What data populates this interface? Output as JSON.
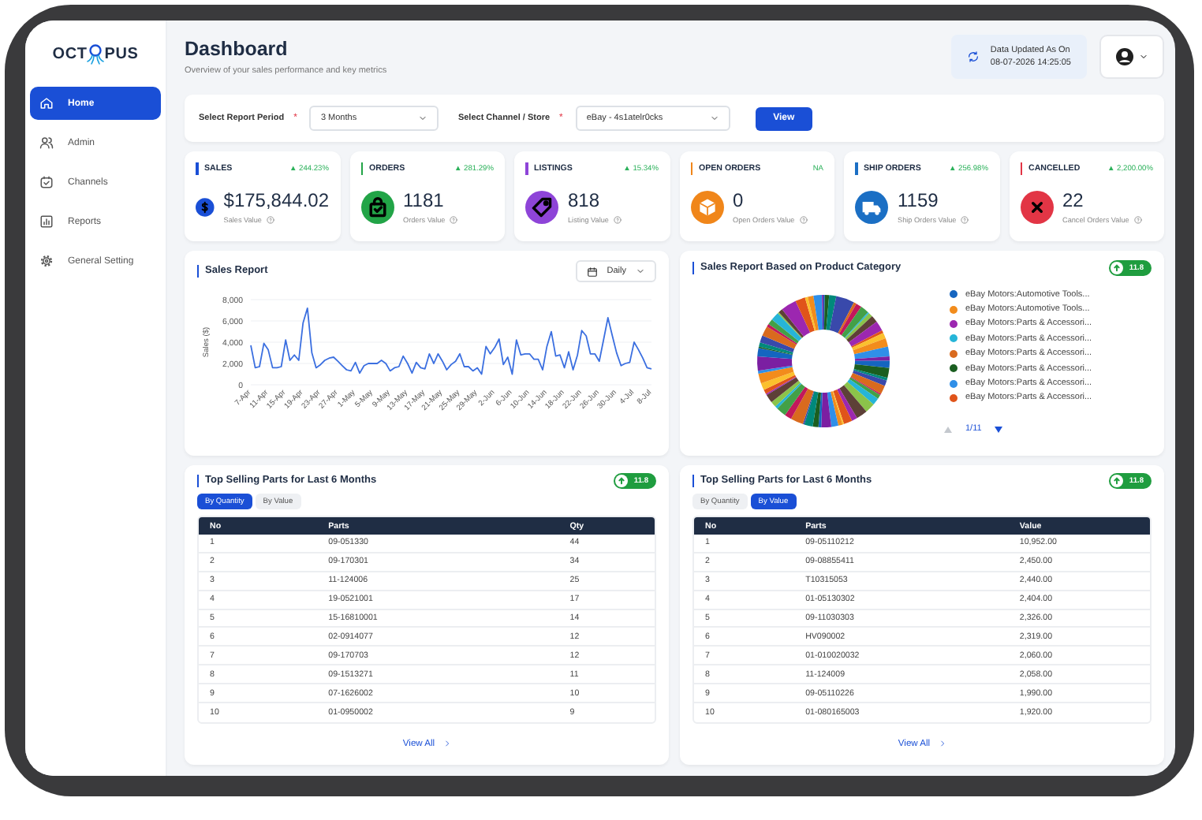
{
  "sidebar": {
    "logo": [
      "OCT",
      "PUS"
    ],
    "items": [
      {
        "label": "Home",
        "selected": true
      },
      {
        "label": "Admin",
        "selected": false
      },
      {
        "label": "Channels",
        "selected": false
      },
      {
        "label": "Reports",
        "selected": false
      },
      {
        "label": "General Setting",
        "selected": false
      }
    ]
  },
  "header": {
    "title": "Dashboard",
    "subtitle": "Overview of your sales performance and key metrics",
    "updated_label": "Data Updated As On",
    "updated_at": "08-07-2026 14:25:05"
  },
  "filters": {
    "fields": [
      {
        "label": "Select Report Period",
        "required_mark": "*",
        "value": "3 Months"
      },
      {
        "label": "Select Channel / Store",
        "required_mark": "*",
        "value": "eBay - 4s1atelr0cks"
      }
    ],
    "button": "View"
  },
  "kpis": [
    {
      "label": "SALES",
      "change": "▲ 244.23%",
      "value": "$175,844.02",
      "caption": "Sales Value",
      "color": "#1a4fd6"
    },
    {
      "label": "ORDERS",
      "change": "▲ 281.29%",
      "value": "1181",
      "caption": "Orders Value",
      "color": "#22a447"
    },
    {
      "label": "LISTINGS",
      "change": "▲ 15.34%",
      "value": "818",
      "caption": "Listing Value",
      "color": "#8e44d8"
    },
    {
      "label": "OPEN ORDERS",
      "change": "NA",
      "value": "0",
      "caption": "Open Orders Value",
      "color": "#f0861a"
    },
    {
      "label": "SHIP ORDERS",
      "change": "▲ 256.98%",
      "value": "1159",
      "caption": "Ship Orders Value",
      "color": "#1b6fc4"
    },
    {
      "label": "CANCELLED",
      "change": "▲ 2,200.00%",
      "value": "22",
      "caption": "Cancel Orders Value",
      "color": "#e23545"
    }
  ],
  "sales_report": {
    "control": "Daily",
    "chart_data": {
      "type": "line",
      "title": "Sales Report",
      "ylabel": "Sales ($)",
      "ylim": [
        0,
        8000
      ],
      "grid": true,
      "categories": [
        "7-Apr",
        null,
        null,
        null,
        "11-Apr",
        null,
        null,
        null,
        "15-Apr",
        null,
        null,
        null,
        "19-Apr",
        null,
        null,
        null,
        "23-Apr",
        null,
        null,
        null,
        "27-Apr",
        null,
        null,
        null,
        "1-May",
        null,
        null,
        null,
        "5-May",
        null,
        null,
        null,
        "9-May",
        null,
        null,
        null,
        "13-May",
        null,
        null,
        null,
        "17-May",
        null,
        null,
        null,
        "21-May",
        null,
        null,
        null,
        "25-May",
        null,
        null,
        null,
        "29-May",
        null,
        null,
        null,
        "2-Jun",
        null,
        null,
        null,
        "6-Jun",
        null,
        null,
        null,
        "10-Jun",
        null,
        null,
        null,
        "14-Jun",
        null,
        null,
        null,
        "18-Jun",
        null,
        null,
        null,
        "22-Jun",
        null,
        null,
        null,
        "26-Jun",
        null,
        null,
        null,
        "30-Jun",
        null,
        null,
        null,
        "4-Jul",
        null,
        null,
        null,
        "8-Jul"
      ],
      "yticks": [
        {
          "value": 0,
          "label": "0"
        },
        {
          "value": 2000,
          "label": "2,000"
        },
        {
          "value": 4000,
          "label": "4,000"
        },
        {
          "value": 6000,
          "label": "6,000"
        },
        {
          "value": 8000,
          "label": "8,000"
        }
      ],
      "series": [
        {
          "color": "#3b6fe0",
          "values": [
            3700,
            1600,
            1700,
            3900,
            3300,
            1600,
            1600,
            1700,
            4200,
            2300,
            2800,
            2300,
            5800,
            7200,
            3000,
            1600,
            1900,
            2300,
            2500,
            2600,
            2200,
            1800,
            1400,
            1300,
            2100,
            1100,
            1800,
            2000,
            2000,
            2000,
            2300,
            2000,
            1300,
            1600,
            1700,
            2700,
            2000,
            1100,
            2100,
            1600,
            1500,
            2900,
            2000,
            2900,
            2200,
            1400,
            1900,
            2200,
            2900,
            1700,
            1700,
            1300,
            1600,
            1000,
            3600,
            2900,
            3500,
            4300,
            1900,
            2600,
            1000,
            4200,
            2800,
            2900,
            2900,
            2400,
            2400,
            1400,
            3600,
            5000,
            2700,
            2800,
            1600,
            3100,
            1400,
            2800,
            5100,
            4600,
            2900,
            2900,
            2200,
            4200,
            6300,
            4600,
            3000,
            1800,
            2000,
            2100,
            4000,
            3300,
            2500,
            1600,
            1500
          ]
        }
      ]
    }
  },
  "category_report": {
    "title": "Sales Report Based on Product Category",
    "badge": "11.8",
    "legend": [
      {
        "label": "eBay Motors:Automotive Tools...",
        "color": "#1565c0"
      },
      {
        "label": "eBay Motors:Automotive Tools...",
        "color": "#f28c1c"
      },
      {
        "label": "eBay Motors:Parts & Accessori...",
        "color": "#9c27b0"
      },
      {
        "label": "eBay Motors:Parts & Accessori...",
        "color": "#26b5d8"
      },
      {
        "label": "eBay Motors:Parts & Accessori...",
        "color": "#d96a1e"
      },
      {
        "label": "eBay Motors:Parts & Accessori...",
        "color": "#1b5e20"
      },
      {
        "label": "eBay Motors:Parts & Accessori...",
        "color": "#2f8fe8"
      },
      {
        "label": "eBay Motors:Parts & Accessori...",
        "color": "#e0541a"
      }
    ],
    "pager": {
      "text": "1/11",
      "prev_disabled": true,
      "next_disabled": false
    }
  },
  "tables": [
    {
      "title": "Top Selling Parts for Last 6 Months",
      "badge": "11.8",
      "toggles": [
        {
          "label": "By Quantity",
          "selected": true
        },
        {
          "label": "By Value",
          "selected": false
        }
      ],
      "columns": [
        "No",
        "Parts",
        "Qty"
      ],
      "rows": [
        [
          "1",
          "09-051330",
          "44"
        ],
        [
          "2",
          "09-170301",
          "34"
        ],
        [
          "3",
          "11-124006",
          "25"
        ],
        [
          "4",
          "19-0521001",
          "17"
        ],
        [
          "5",
          "15-16810001",
          "14"
        ],
        [
          "6",
          "02-0914077",
          "12"
        ],
        [
          "7",
          "09-170703",
          "12"
        ],
        [
          "8",
          "09-1513271",
          "11"
        ],
        [
          "9",
          "07-1626002",
          "10"
        ],
        [
          "10",
          "01-0950002",
          "9"
        ]
      ],
      "link": "View All"
    },
    {
      "title": "Top Selling Parts for Last 6 Months",
      "badge": "11.8",
      "toggles": [
        {
          "label": "By Quantity",
          "selected": false
        },
        {
          "label": "By Value",
          "selected": true
        }
      ],
      "columns": [
        "No",
        "Parts",
        "Value"
      ],
      "rows": [
        [
          "1",
          "09-05110212",
          "10,952.00"
        ],
        [
          "2",
          "09-08855411",
          "2,450.00"
        ],
        [
          "3",
          "T10315053",
          "2,440.00"
        ],
        [
          "4",
          "01-05130302",
          "2,404.00"
        ],
        [
          "5",
          "09-11030303",
          "2,326.00"
        ],
        [
          "6",
          "HV090002",
          "2,319.00"
        ],
        [
          "7",
          "01-010020032",
          "2,060.00"
        ],
        [
          "8",
          "11-124009",
          "2,058.00"
        ],
        [
          "9",
          "09-05110226",
          "1,990.00"
        ],
        [
          "10",
          "01-080165003",
          "1,920.00"
        ]
      ],
      "link": "View All"
    }
  ]
}
